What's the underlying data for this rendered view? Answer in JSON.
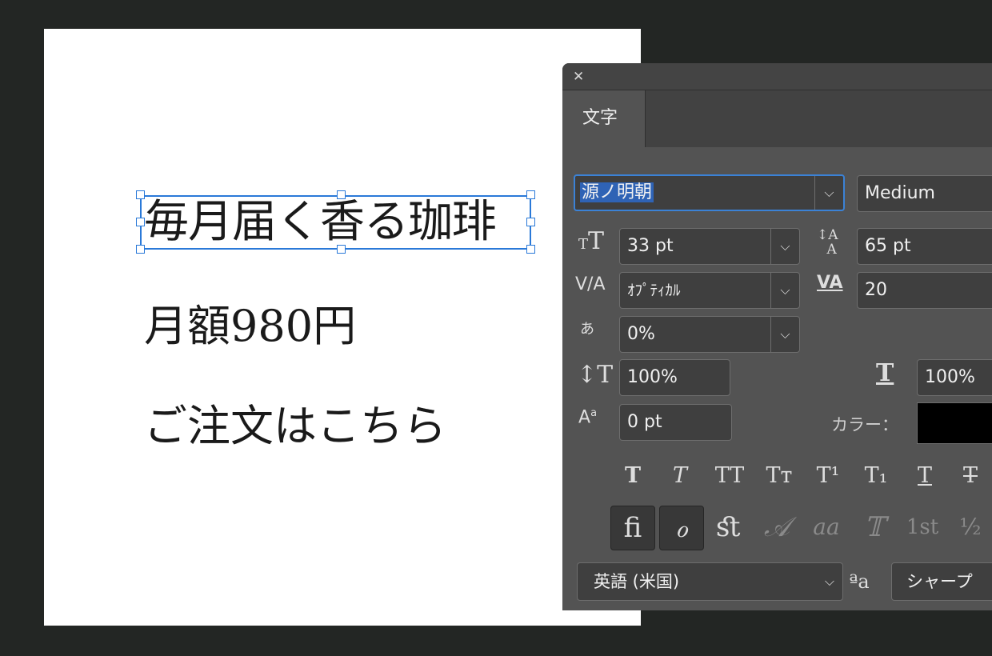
{
  "canvas": {
    "line1": "毎月届く香る珈琲",
    "line2": "月額980円",
    "line3": "ご注文はこちら"
  },
  "panel": {
    "close_icon": "✕",
    "tab": "文字",
    "font_family": "源ノ明朝",
    "font_style": "Medium",
    "font_size": "33 pt",
    "leading": "65 pt",
    "kerning": "ｵﾌﾟﾃｨｶﾙ",
    "tracking": "20",
    "tsume": "0%",
    "vertical_scale": "100%",
    "horizontal_scale": "100%",
    "baseline_shift": "0 pt",
    "color_label": "カラー：",
    "color_value": "#000000",
    "language": "英語 (米国)",
    "antialias": "シャープ",
    "aa_icon": "ªa",
    "style_buttons": [
      "T",
      "T",
      "TT",
      "Tт",
      "T¹",
      "T₁",
      "T",
      "T"
    ],
    "opentype_buttons": [
      "ﬁ",
      "ℴ",
      "ﬆ",
      "𝒜",
      "aa",
      "𝕋",
      "1st",
      "½"
    ]
  }
}
